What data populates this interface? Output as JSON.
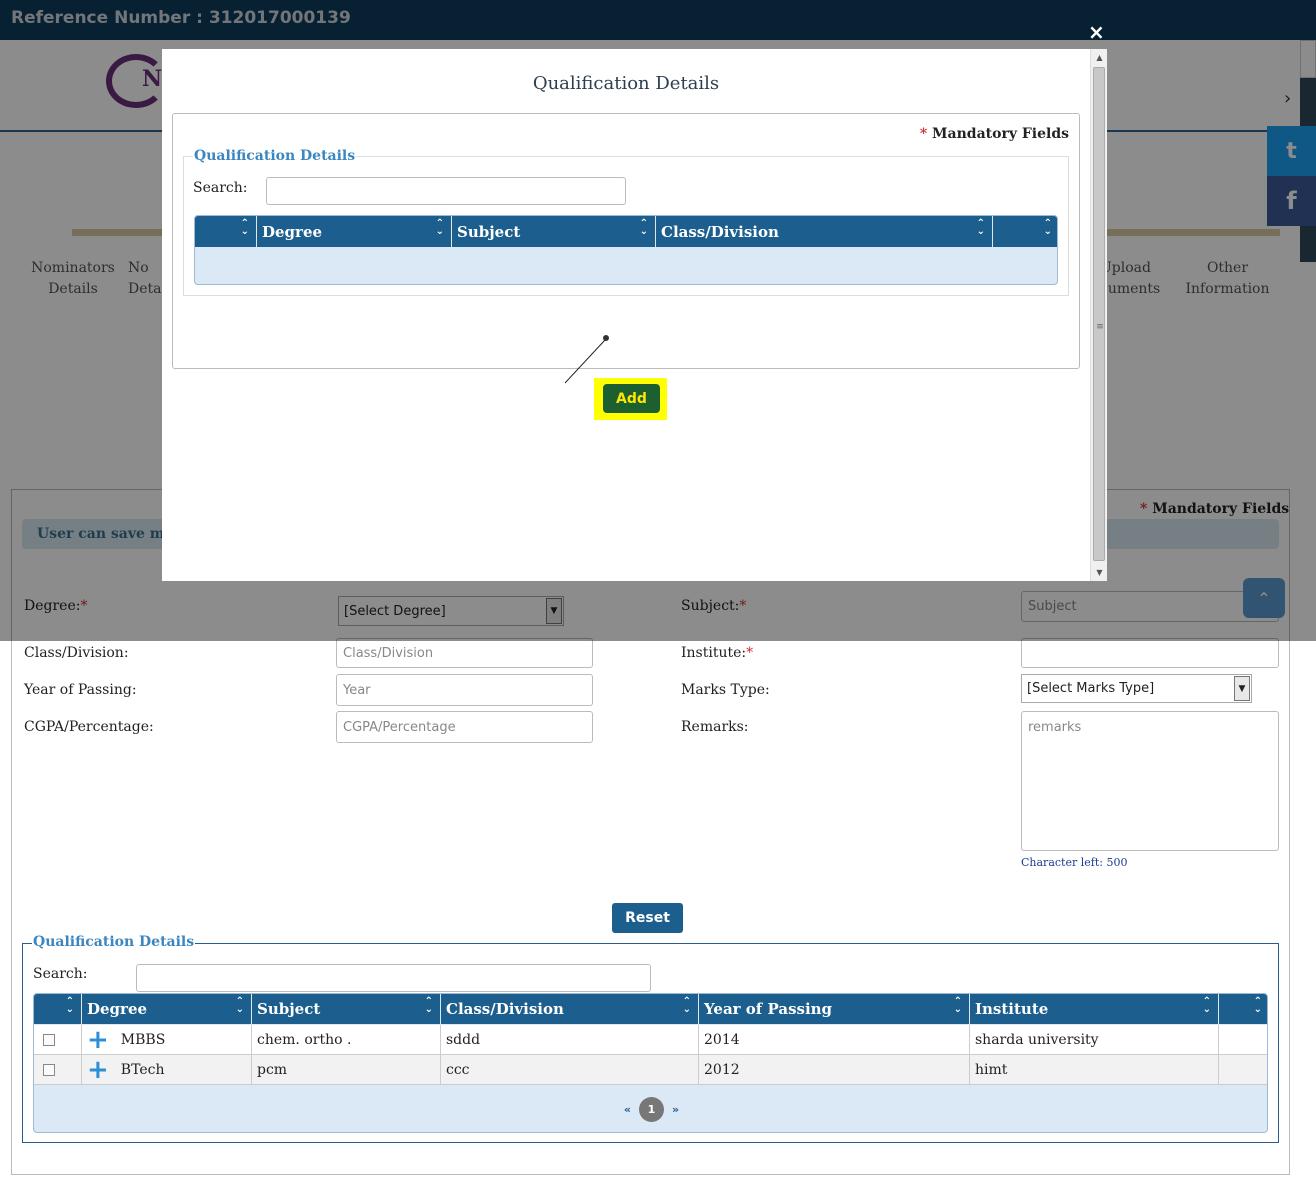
{
  "topbar": {
    "reference": "Reference Number : 312017000139"
  },
  "header": {
    "logo_letter": "N",
    "next_arrow": "›"
  },
  "steps": [
    {
      "id": "nominators",
      "label": "Nominators\nDetails"
    },
    {
      "id": "nominee",
      "label": "No\nDetai"
    },
    {
      "id": "upload",
      "label": "Upload\ncuments"
    },
    {
      "id": "other",
      "label": "Other\nInformation"
    }
  ],
  "form": {
    "mandatory_note": "Mandatory Fields",
    "info_text": "User can save mult",
    "degree_label": "Degree:",
    "degree_value": "[Select Degree]",
    "subject_label": "Subject:",
    "subject_placeholder": "Subject",
    "class_label": "Class/Division:",
    "class_placeholder": "Class/Division",
    "institute_label": "Institute:",
    "year_label": "Year of Passing:",
    "year_placeholder": "Year",
    "marks_label": "Marks Type:",
    "marks_value": "[Select Marks Type]",
    "cgpa_label": "CGPA/Percentage:",
    "cgpa_placeholder": "CGPA/Percentage",
    "remarks_label": "Remarks:",
    "remarks_placeholder": "remarks",
    "char_left": "Character left: 500",
    "reset_label": "Reset"
  },
  "qualification_table": {
    "legend": "Qualification Details",
    "search_label": "Search:",
    "columns": [
      "",
      "Degree",
      "Subject",
      "Class/Division",
      "Year of Passing",
      "Institute",
      ""
    ],
    "rows": [
      {
        "degree": "MBBS",
        "subject": "chem. ortho .",
        "class": "sddd",
        "year": "2014",
        "institute": "sharda university"
      },
      {
        "degree": "BTech",
        "subject": "pcm",
        "class": "ccc",
        "year": "2012",
        "institute": "himt"
      }
    ],
    "pager": {
      "prev": "«",
      "page": "1",
      "next": "»"
    }
  },
  "social": {
    "twitter": "t",
    "facebook": "f"
  },
  "modal": {
    "title": "Qualification Details",
    "close": "×",
    "mandatory_note": "Mandatory Fields",
    "legend": "Qualification Details",
    "search_label": "Search:",
    "columns": [
      "",
      "Degree",
      "Subject",
      "Class/Division",
      ""
    ],
    "add_label": "Add"
  },
  "colors": {
    "header_blue": "#1c5f8f",
    "highlight": "#ffff00",
    "add_button": "#1c6030"
  }
}
